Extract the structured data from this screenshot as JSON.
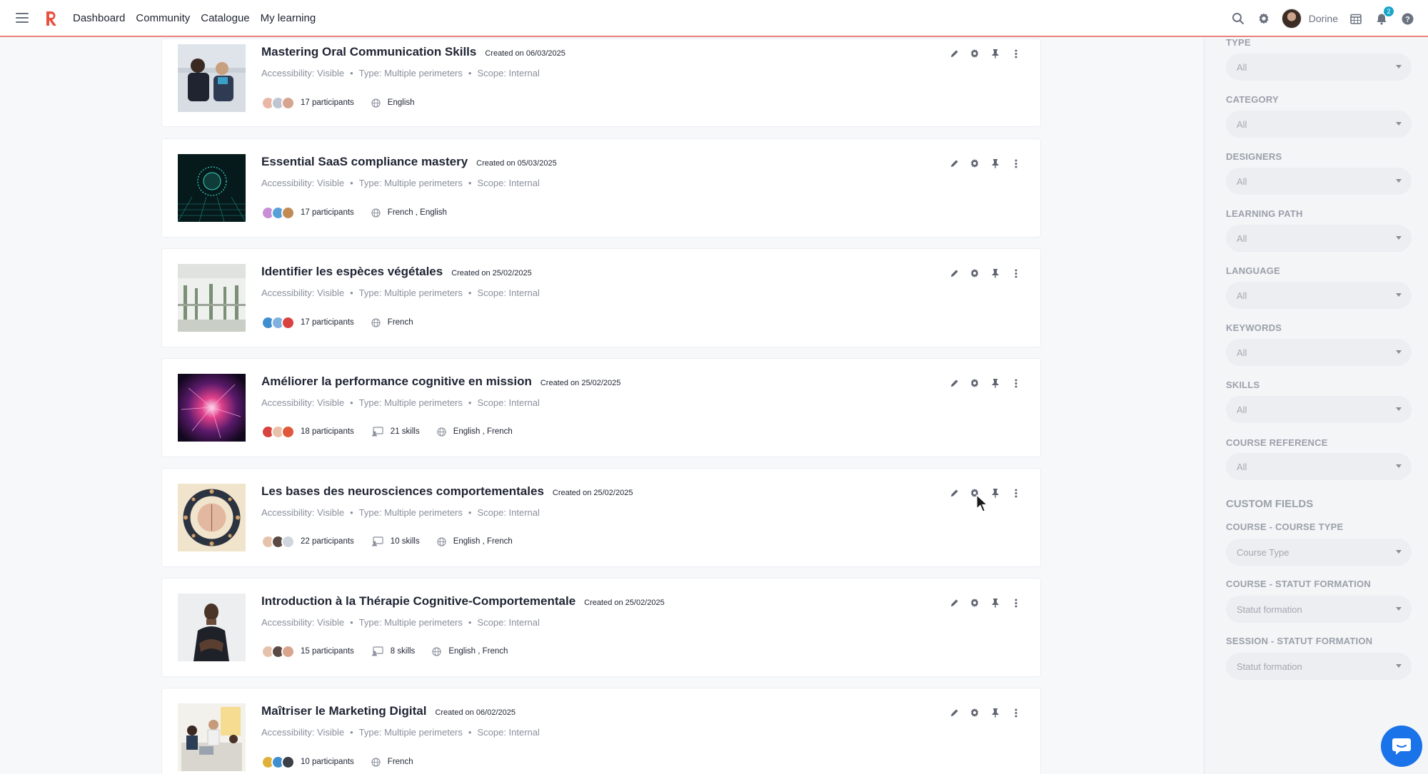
{
  "nav": {
    "items": [
      "Dashboard",
      "Community",
      "Catalogue",
      "My learning"
    ]
  },
  "user": {
    "name": "Dorine"
  },
  "notifications": {
    "count": "2"
  },
  "brand": {
    "accent": "#e8503f"
  },
  "courses": [
    {
      "title": "Mastering Oral Communication Skills",
      "created": "Created on 06/03/2025",
      "accessibility": "Accessibility: Visible",
      "type": "Type: Multiple perimeters",
      "scope": "Scope: Internal",
      "participants": "17 participants",
      "skills": "",
      "languages": "English"
    },
    {
      "title": "Essential SaaS compliance mastery",
      "created": "Created on 05/03/2025",
      "accessibility": "Accessibility: Visible",
      "type": "Type: Multiple perimeters",
      "scope": "Scope: Internal",
      "participants": "17 participants",
      "skills": "",
      "languages": "French , English"
    },
    {
      "title": "Identifier les espèces végétales",
      "created": "Created on 25/02/2025",
      "accessibility": "Accessibility: Visible",
      "type": "Type: Multiple perimeters",
      "scope": "Scope: Internal",
      "participants": "17 participants",
      "skills": "",
      "languages": "French"
    },
    {
      "title": "Améliorer la performance cognitive en mission",
      "created": "Created on 25/02/2025",
      "accessibility": "Accessibility: Visible",
      "type": "Type: Multiple perimeters",
      "scope": "Scope: Internal",
      "participants": "18 participants",
      "skills": "21 skills",
      "languages": "English , French"
    },
    {
      "title": "Les bases des neurosciences comportementales",
      "created": "Created on 25/02/2025",
      "accessibility": "Accessibility: Visible",
      "type": "Type: Multiple perimeters",
      "scope": "Scope: Internal",
      "participants": "22 participants",
      "skills": "10 skills",
      "languages": "English , French"
    },
    {
      "title": "Introduction à la Thérapie Cognitive-Comportementale",
      "created": "Created on 25/02/2025",
      "accessibility": "Accessibility: Visible",
      "type": "Type: Multiple perimeters",
      "scope": "Scope: Internal",
      "participants": "15 participants",
      "skills": "8 skills",
      "languages": "English , French"
    },
    {
      "title": "Maîtriser le Marketing Digital",
      "created": "Created on 06/02/2025",
      "accessibility": "Accessibility: Visible",
      "type": "Type: Multiple perimeters",
      "scope": "Scope: Internal",
      "participants": "10 participants",
      "skills": "",
      "languages": "French"
    }
  ],
  "filters": {
    "items": [
      {
        "label": "TYPE",
        "value": "All"
      },
      {
        "label": "CATEGORY",
        "value": "All"
      },
      {
        "label": "DESIGNERS",
        "value": "All"
      },
      {
        "label": "LEARNING PATH",
        "value": "All"
      },
      {
        "label": "LANGUAGE",
        "value": "All"
      },
      {
        "label": "KEYWORDS",
        "value": "All"
      },
      {
        "label": "SKILLS",
        "value": "All"
      },
      {
        "label": "COURSE REFERENCE",
        "value": "All"
      }
    ],
    "custom_title": "CUSTOM FIELDS",
    "custom": [
      {
        "label": "COURSE - COURSE TYPE",
        "value": "Course Type"
      },
      {
        "label": "COURSE - STATUT FORMATION",
        "value": "Statut formation"
      },
      {
        "label": "SESSION - STATUT FORMATION",
        "value": "Statut formation"
      }
    ]
  }
}
